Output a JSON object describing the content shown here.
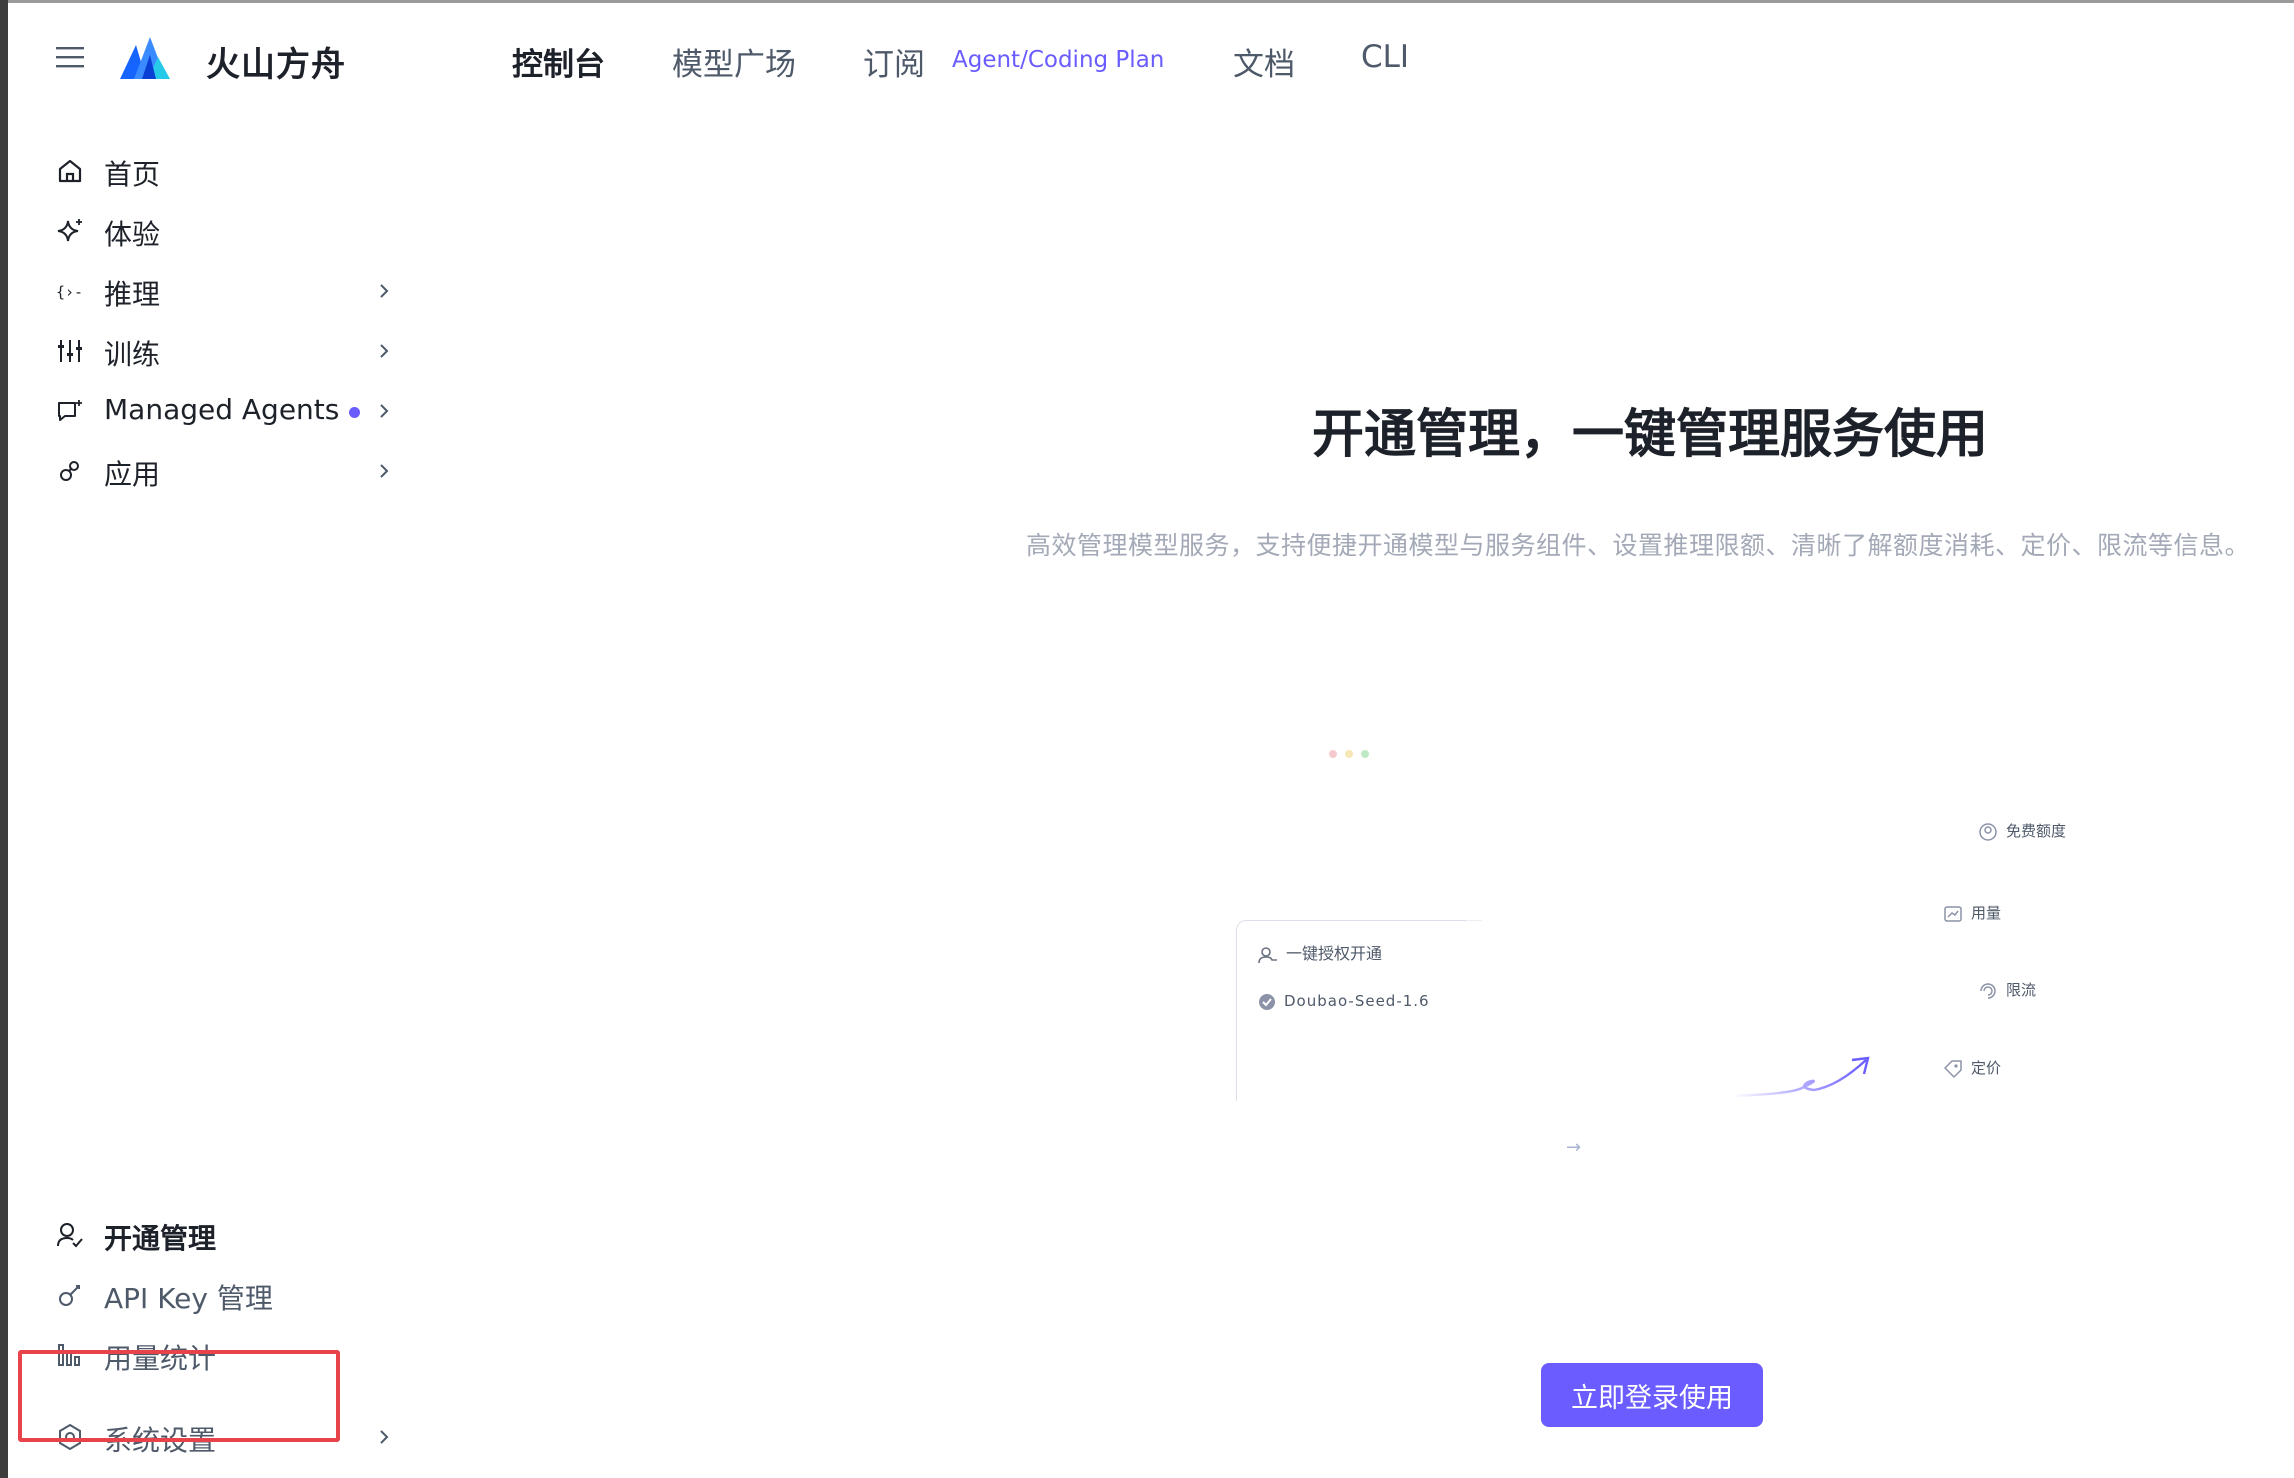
{
  "brand": {
    "name": "火山方舟"
  },
  "nav": {
    "items": [
      {
        "label": "控制台",
        "active": true
      },
      {
        "label": "模型广场"
      },
      {
        "label": "订阅"
      },
      {
        "label": "文档"
      },
      {
        "label": "CLI"
      }
    ],
    "subscribe_tag": "Agent/Coding Plan"
  },
  "sidebar": {
    "items": [
      {
        "label": "首页",
        "icon": "home-icon"
      },
      {
        "label": "体验",
        "icon": "sparkle-icon"
      },
      {
        "label": "推理",
        "icon": "code-braces-icon",
        "expandable": true
      },
      {
        "label": "训练",
        "icon": "sliders-icon",
        "expandable": true
      },
      {
        "label": "Managed Agents",
        "icon": "chat-agent-icon",
        "expandable": true,
        "badge_dot": true
      },
      {
        "label": "应用",
        "icon": "apps-icon",
        "expandable": true
      }
    ],
    "bottom_items": [
      {
        "label": "开通管理",
        "icon": "user-check-icon",
        "active": true
      },
      {
        "label": "API Key 管理",
        "icon": "key-icon",
        "highlighted": true
      },
      {
        "label": "用量统计",
        "icon": "bar-chart-icon"
      },
      {
        "label": "系统设置",
        "icon": "settings-icon",
        "expandable": true
      }
    ]
  },
  "main": {
    "title": "开通管理，一键管理服务使用",
    "subtitle": "高效管理模型服务，支持便捷开通模型与服务组件、设置推理限额、清晰了解额度消耗、定价、限流等信息。",
    "card": {
      "row1": "一键授权开通",
      "row2": "Doubao-Seed-1.6"
    },
    "features": [
      "免费额度",
      "用量",
      "限流",
      "定价"
    ],
    "cta": "立即登录使用"
  },
  "colors": {
    "accent": "#6a5cff",
    "highlight_border": "#e8424a",
    "text_primary": "#1d2129",
    "text_secondary": "#4e5969",
    "text_muted": "#a3a9b6"
  }
}
